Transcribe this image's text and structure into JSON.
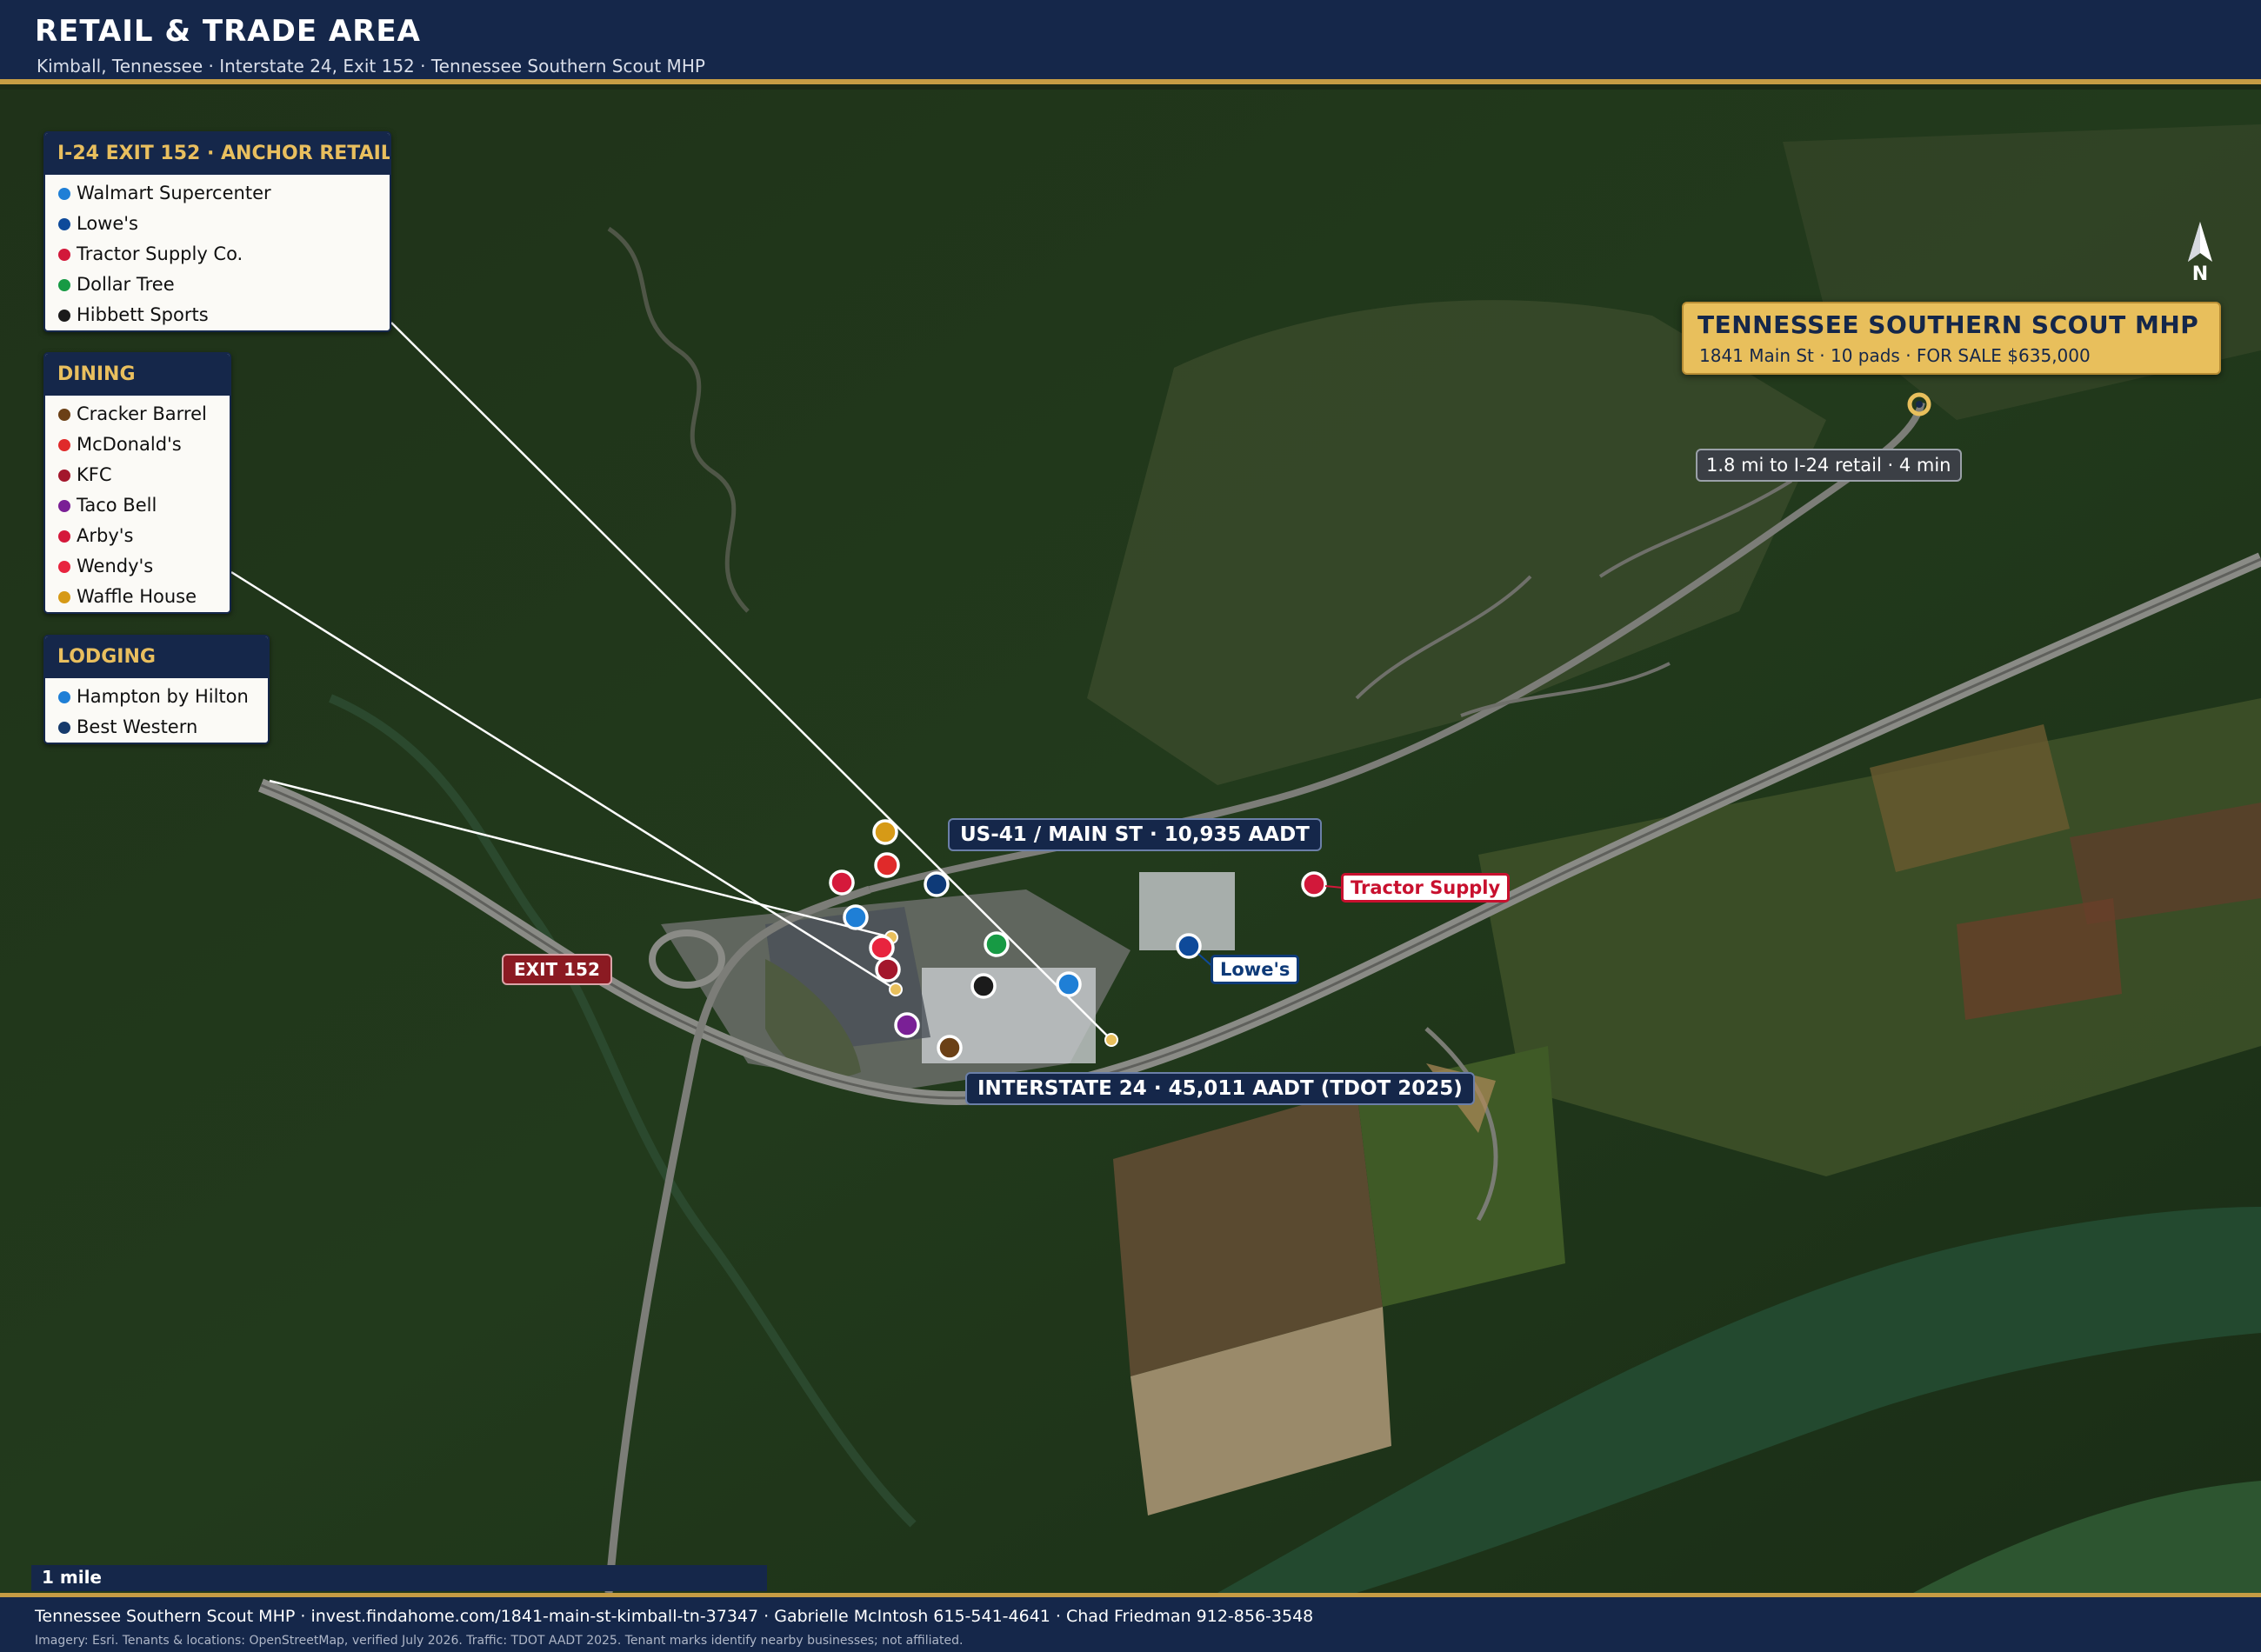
{
  "header": {
    "title": "RETAIL & TRADE AREA",
    "subtitle": "Kimball, Tennessee  ·  Interstate 24, Exit 152  ·  Tennessee Southern Scout MHP"
  },
  "legends": {
    "anchor": {
      "title": "I-24 EXIT 152  ·  ANCHOR RETAIL",
      "items": [
        {
          "label": "Walmart Supercenter",
          "color": "#1f7fd6"
        },
        {
          "label": "Lowe's",
          "color": "#0e4a9a"
        },
        {
          "label": "Tractor Supply Co.",
          "color": "#d2183a"
        },
        {
          "label": "Dollar Tree",
          "color": "#179a44"
        },
        {
          "label": "Hibbett Sports",
          "color": "#1b1b1b"
        }
      ]
    },
    "dining": {
      "title": "DINING",
      "items": [
        {
          "label": "Cracker Barrel",
          "color": "#6b4016"
        },
        {
          "label": "McDonald's",
          "color": "#e02a2a"
        },
        {
          "label": "KFC",
          "color": "#a3172c"
        },
        {
          "label": "Taco Bell",
          "color": "#7a2096"
        },
        {
          "label": "Arby's",
          "color": "#d5193b"
        },
        {
          "label": "Wendy's",
          "color": "#e8243e"
        },
        {
          "label": "Waffle House",
          "color": "#d69a17"
        }
      ]
    },
    "lodging": {
      "title": "LODGING",
      "items": [
        {
          "label": "Hampton by Hilton",
          "color": "#1f7fd6"
        },
        {
          "label": "Best Western",
          "color": "#163a6b"
        }
      ]
    }
  },
  "map_labels": {
    "us41": "US-41 / MAIN ST  ·  10,935 AADT",
    "i24": "INTERSTATE 24  ·  45,011 AADT (TDOT 2025)",
    "exit": "EXIT 152",
    "tractor_supply": "Tractor Supply",
    "lowes": "Lowe's",
    "drive": "1.8 mi to I-24 retail  ·  4 min"
  },
  "property": {
    "name": "TENNESSEE SOUTHERN SCOUT MHP",
    "detail": "1841 Main St  ·  10 pads  ·  FOR SALE $635,000"
  },
  "north": "N",
  "scale": "1 mile",
  "footer": {
    "line1": "Tennessee Southern Scout MHP  ·  invest.findahome.com/1841-main-st-kimball-tn-37347  ·  Gabrielle McIntosh 615-541-4641  ·  Chad Friedman 912-856-3548",
    "line2": "Imagery: Esri. Tenants & locations: OpenStreetMap, verified July 2026. Traffic: TDOT AADT 2025. Tenant marks identify nearby businesses; not affiliated."
  },
  "colors": {
    "navy": "#15274a",
    "gold": "#c69c44",
    "property_gold": "#e8bf5c"
  }
}
